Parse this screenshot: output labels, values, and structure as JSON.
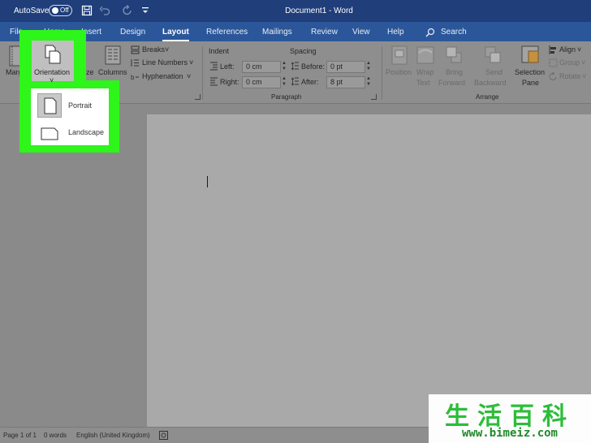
{
  "titlebar": {
    "autosave_label": "AutoSave",
    "autosave_state": "Off",
    "doc_title": "Document1 - Word"
  },
  "tabs": [
    {
      "label": "File"
    },
    {
      "label": "Home"
    },
    {
      "label": "Insert"
    },
    {
      "label": "Design"
    },
    {
      "label": "Layout"
    },
    {
      "label": "References"
    },
    {
      "label": "Mailings"
    },
    {
      "label": "Review"
    },
    {
      "label": "View"
    },
    {
      "label": "Help"
    },
    {
      "label": "Search"
    }
  ],
  "ribbon": {
    "page_setup": {
      "margins": "Margins",
      "orientation": "Orientation",
      "size": "Size",
      "columns": "Columns",
      "breaks": "Breaks",
      "line_numbers": "Line Numbers",
      "hyphenation": "Hyphenation"
    },
    "paragraph": {
      "indent_title": "Indent",
      "spacing_title": "Spacing",
      "left_label": "Left:",
      "left_value": "0 cm",
      "right_label": "Right:",
      "right_value": "0 cm",
      "before_label": "Before:",
      "before_value": "0 pt",
      "after_label": "After:",
      "after_value": "8 pt",
      "group_label": "Paragraph"
    },
    "arrange": {
      "position": "Position",
      "wrap_text_1": "Wrap",
      "wrap_text_2": "Text",
      "bring_forward_1": "Bring",
      "bring_forward_2": "Forward",
      "send_backward_1": "Send",
      "send_backward_2": "Backward",
      "selection_pane_1": "Selection",
      "selection_pane_2": "Pane",
      "align": "Align",
      "group": "Group",
      "rotate": "Rotate",
      "group_label": "Arrange"
    }
  },
  "orientation_menu": {
    "portrait": "Portrait",
    "landscape": "Landscape"
  },
  "statusbar": {
    "page": "Page 1 of 1",
    "words": "0 words",
    "language": "English (United Kingdom)"
  },
  "watermark": {
    "chinese": "生活百科",
    "url": "www.bimeiz.com"
  },
  "colors": {
    "title_bar": "#1f3e7a",
    "ribbon_tabs": "#2b579a",
    "highlight": "#2ef51a",
    "watermark_green": "#2cbd3a"
  }
}
